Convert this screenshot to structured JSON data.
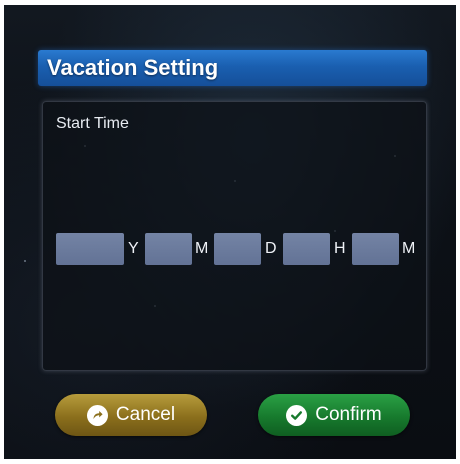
{
  "dialog": {
    "title": "Vacation Setting",
    "start_time_label": "Start Time"
  },
  "time_fields": {
    "year": {
      "value": "",
      "unit": "Y"
    },
    "month": {
      "value": "",
      "unit": "M"
    },
    "day": {
      "value": "",
      "unit": "D"
    },
    "hour": {
      "value": "",
      "unit": "H"
    },
    "minute": {
      "value": "",
      "unit": "M"
    }
  },
  "buttons": {
    "cancel": {
      "label": "Cancel",
      "icon": "redo-arrow-icon"
    },
    "confirm": {
      "label": "Confirm",
      "icon": "check-circle-icon"
    }
  },
  "colors": {
    "title_bar": "#1a5fb0",
    "input_box": "#7385aa",
    "cancel_button": "#8b6f1c",
    "confirm_button": "#177a2d"
  }
}
